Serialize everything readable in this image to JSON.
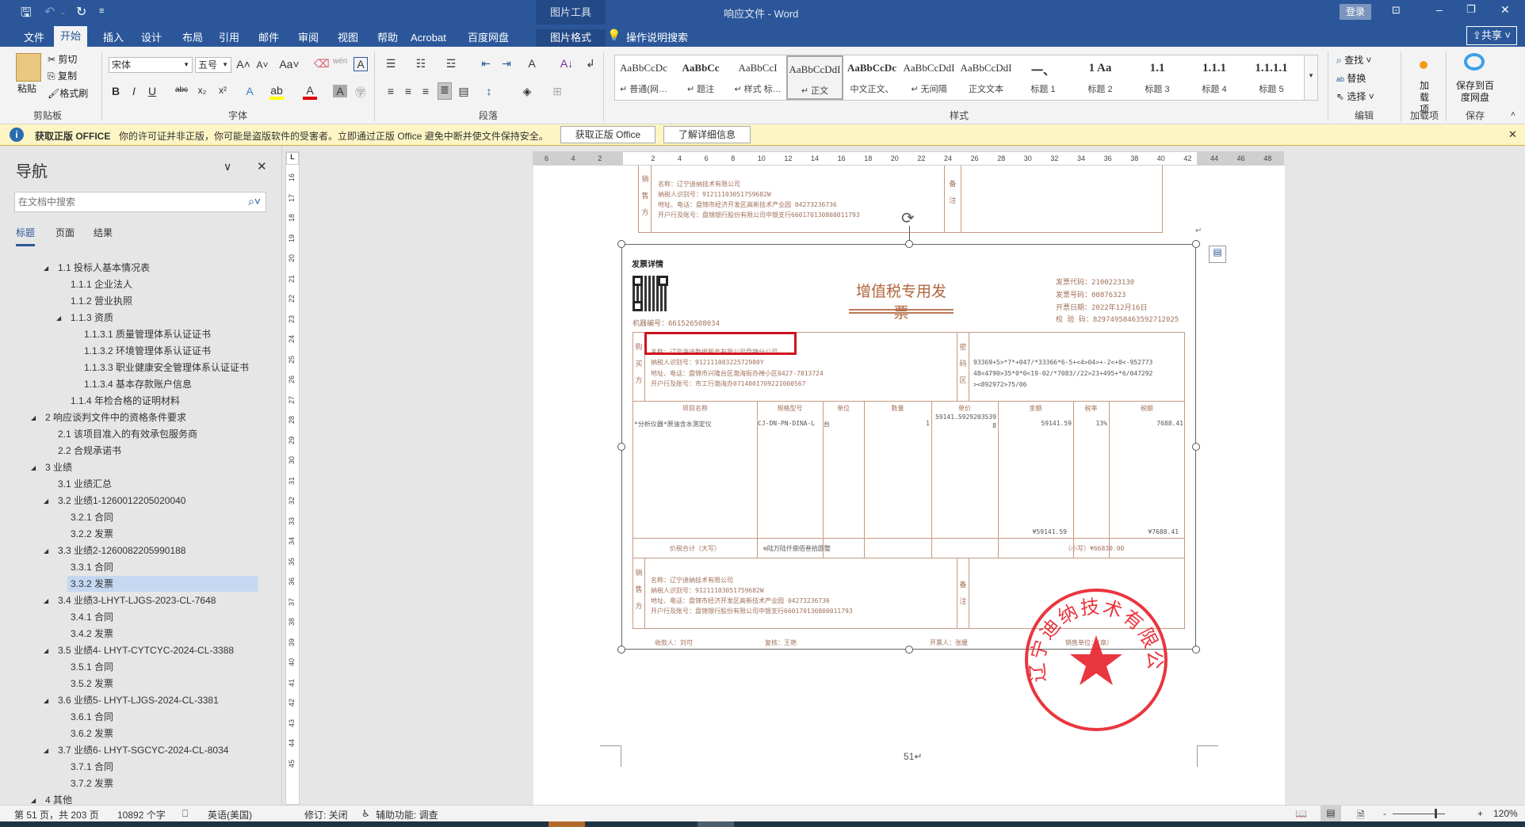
{
  "titlebar": {
    "picture_tools": "图片工具",
    "title": "响应文件  -  Word",
    "login": "登录",
    "tell_me": "操作说明搜索",
    "share": "共享"
  },
  "tabs": [
    "文件",
    "开始",
    "插入",
    "设计",
    "布局",
    "引用",
    "邮件",
    "审阅",
    "视图",
    "帮助",
    "Acrobat",
    "百度网盘",
    "图片格式"
  ],
  "active_tab": "开始",
  "ribbon": {
    "clipboard": {
      "paste": "粘贴",
      "cut": "剪切",
      "copy": "复制",
      "format_painter": "格式刷",
      "label": "剪贴板"
    },
    "font": {
      "name": "宋体",
      "size": "五号",
      "label": "字体"
    },
    "paragraph": {
      "label": "段落"
    },
    "styles": {
      "label": "样式",
      "items": [
        {
          "preview": "AaBbCcDc",
          "label": "↵ 普通(网…"
        },
        {
          "preview": "AaBbCc",
          "label": "↵ 题注"
        },
        {
          "preview": "AaBbCcI",
          "label": "↵ 样式 标…"
        },
        {
          "preview": "AaBbCcDdI",
          "label": "↵ 正文"
        },
        {
          "preview": "AaBbCcDc",
          "label": "中文正文、"
        },
        {
          "preview": "AaBbCcDdI",
          "label": "↵ 无间隔"
        },
        {
          "preview": "AaBbCcDdI",
          "label": "正文文本"
        },
        {
          "preview": "一、",
          "label": "标题 1"
        },
        {
          "preview": "1   Aa",
          "label": "标题 2"
        },
        {
          "preview": "1.1",
          "label": "标题 3"
        },
        {
          "preview": "1.1.1",
          "label": "标题 4"
        },
        {
          "preview": "1.1.1.1",
          "label": "标题 5"
        }
      ],
      "selected_index": 3
    },
    "editing": {
      "find": "查找",
      "replace": "替换",
      "select": "选择",
      "label": "编辑"
    },
    "addins": {
      "button": "加载项",
      "label": "加载项"
    },
    "save": {
      "button": "保存到百度网盘",
      "label": "保存"
    }
  },
  "notice": {
    "title": "获取正版 OFFICE",
    "message": "你的许可证并非正版，你可能是盗版软件的受害者。立即通过正版 Office 避免中断并使文件保持安全。",
    "get_button": "获取正版 Office",
    "learn_button": "了解详细信息"
  },
  "nav": {
    "title": "导航",
    "search_placeholder": "在文档中搜索",
    "tabs": [
      "标题",
      "页面",
      "结果"
    ],
    "items": [
      {
        "text": "1.1 投标人基本情况表",
        "level": 2,
        "expanded": true
      },
      {
        "text": "1.1.1 企业法人",
        "level": 3
      },
      {
        "text": "1.1.2 营业执照",
        "level": 3
      },
      {
        "text": "1.1.3 资质",
        "level": 3,
        "expanded": true
      },
      {
        "text": "1.1.3.1 质量管理体系认证证书",
        "level": 4
      },
      {
        "text": "1.1.3.2 环境管理体系认证证书",
        "level": 4
      },
      {
        "text": "1.1.3.3 职业健康安全管理体系认证证书",
        "level": 4
      },
      {
        "text": "1.1.3.4 基本存款账户信息",
        "level": 4
      },
      {
        "text": "1.1.4 年检合格的证明材料",
        "level": 3
      },
      {
        "text": "2 响应谈判文件中的资格条件要求",
        "level": 1,
        "expanded": true
      },
      {
        "text": "2.1 该项目准入的有效承包服务商",
        "level": 2
      },
      {
        "text": "2.2 合规承诺书",
        "level": 2
      },
      {
        "text": "3 业绩",
        "level": 1,
        "expanded": true
      },
      {
        "text": "3.1 业绩汇总",
        "level": 2
      },
      {
        "text": "3.2 业绩1-1260012205020040",
        "level": 2,
        "expanded": true
      },
      {
        "text": "3.2.1 合同",
        "level": 3
      },
      {
        "text": "3.2.2 发票",
        "level": 3
      },
      {
        "text": "3.3 业绩2-1260082205990188",
        "level": 2,
        "expanded": true
      },
      {
        "text": "3.3.1 合同",
        "level": 3
      },
      {
        "text": "3.3.2 发票",
        "level": 3,
        "selected": true
      },
      {
        "text": "3.4 业绩3-LHYT-LJGS-2023-CL-7648",
        "level": 2,
        "expanded": true
      },
      {
        "text": "3.4.1 合同",
        "level": 3
      },
      {
        "text": "3.4.2 发票",
        "level": 3
      },
      {
        "text": "3.5 业绩4- LHYT-CYTCYC-2024-CL-3388",
        "level": 2,
        "expanded": true
      },
      {
        "text": "3.5.1 合同",
        "level": 3
      },
      {
        "text": "3.5.2 发票",
        "level": 3
      },
      {
        "text": "3.6 业绩5- LHYT-LJGS-2024-CL-3381",
        "level": 2,
        "expanded": true
      },
      {
        "text": "3.6.1 合同",
        "level": 3
      },
      {
        "text": "3.6.2 发票",
        "level": 3
      },
      {
        "text": "3.7 业绩6- LHYT-SGCYC-2024-CL-8034",
        "level": 2,
        "expanded": true
      },
      {
        "text": "3.7.1 合同",
        "level": 3
      },
      {
        "text": "3.7.2 发票",
        "level": 3
      },
      {
        "text": "4 其他",
        "level": 1,
        "expanded": true
      }
    ]
  },
  "rulers": {
    "corner": "L",
    "horizontal": [
      "6",
      "4",
      "2",
      "",
      "2",
      "4",
      "6",
      "8",
      "10",
      "12",
      "14",
      "16",
      "18",
      "20",
      "22",
      "24",
      "26",
      "28",
      "30",
      "32",
      "34",
      "36",
      "38",
      "40",
      "42",
      "44",
      "46",
      "48"
    ],
    "vertical": [
      "16",
      "17",
      "18",
      "19",
      "20",
      "21",
      "22",
      "23",
      "24",
      "25",
      "26",
      "27",
      "28",
      "29",
      "30",
      "31",
      "32",
      "33",
      "34",
      "35",
      "36",
      "37",
      "38",
      "39",
      "40",
      "41",
      "42",
      "43",
      "44",
      "45"
    ]
  },
  "invoice": {
    "heading": "发票详情",
    "title": "增值税专用发票",
    "machine_no": "机器编号：661526508034",
    "code": "发票代码：2100223130",
    "number": "发票号码：00876323",
    "date": "开票日期：2022年12月16日",
    "check": "校 验 码：82974958463592712025",
    "buyer_label": [
      "购",
      "买",
      "方"
    ],
    "buyer": [
      "名称：辽宁海迪数据服务有限公司盘锦分公司",
      "纳税人识别号：91211100322572980Y",
      "地址、电话：盘锦市兴隆台区渤海街办禅小区0427-7813724",
      "开户行及账号：市工行渤海办0714001709221000567"
    ],
    "cipher_label": [
      "密",
      "码",
      "区"
    ],
    "cipher": [
      "93369+5>*7*+047/*33366*6-5+<4>04>+-2<+0<-952773",
      "48<4790>35*0*0<19-02/*7083//22>23+495+*6/047292",
      "><892972>75/06"
    ],
    "columns": [
      "项目名称",
      "规格型号",
      "单位",
      "数量",
      "单价",
      "金额",
      "税率",
      "税额"
    ],
    "row": {
      "name": "*分析仪器*原油含水测定仪",
      "model": "CJ-DN-PN-DINA-L",
      "unit": "台",
      "qty": "1",
      "price": "59141.59292035398",
      "amount": "59141.59",
      "rate": "13%",
      "tax": "7688.41"
    },
    "sum_amount": "¥59141.59",
    "sum_tax": "¥7688.41",
    "total_label": "价税合计（大写）",
    "total_words": "⊗陆万陆仟捌佰叁拾圆整",
    "total_small": "（小写）¥66830.00",
    "seller_label": [
      "销",
      "售",
      "方"
    ],
    "seller": [
      "名称：辽宁迪纳技术有限公司",
      "纳税人识别号：91211103051759682W",
      "地址、电话：盘锦市经济开发区高新技术产业园 04273236736",
      "开户行及账号：盘锦银行股份有限公司中银支行660170130800011793"
    ],
    "remark_label": [
      "备",
      "注"
    ],
    "payee": "收款人：刘可",
    "reviewer": "复核：王艳",
    "drawer": "开票人：张媛",
    "seller_seal": "销售单位：（章）",
    "stamp_text": "辽宁迪纳技术有限公司"
  },
  "page_number": "51↵",
  "status": {
    "page": "第 51 页，共 203 页",
    "words": "10892 个字",
    "language": "英语(美国)",
    "track": "修订: 关闭",
    "accessibility": "辅助功能: 调查",
    "zoom": "120%"
  },
  "colors": {
    "brand": "#2b579a",
    "stamp": "#e8202a",
    "highlight_box": "#d0101e"
  }
}
